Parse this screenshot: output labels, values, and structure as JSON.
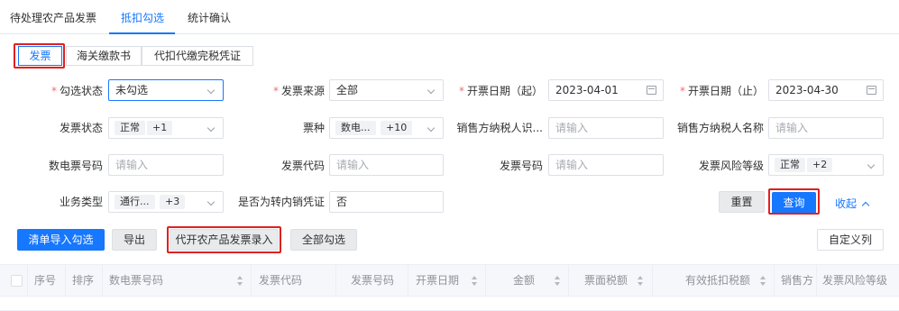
{
  "tabs": [
    "待处理农产品发票",
    "抵扣勾选",
    "统计确认"
  ],
  "subtabs": [
    "发票",
    "海关缴款书",
    "代扣代缴完税凭证"
  ],
  "form": {
    "row1": {
      "select_status_label": "勾选状态",
      "select_status_value": "未勾选",
      "invoice_source_label": "发票来源",
      "invoice_source_value": "全部",
      "date_start_label": "开票日期（起）",
      "date_start_value": "2023-04-01",
      "date_end_label": "开票日期（止）",
      "date_end_value": "2023-04-30"
    },
    "row2": {
      "invoice_status_label": "发票状态",
      "invoice_status_tag": "正常",
      "invoice_status_more": "+1",
      "ticket_type_label": "票种",
      "ticket_type_tag": "数电...",
      "ticket_type_more": "+10",
      "seller_taxid_label": "销售方纳税人识...",
      "seller_taxid_placeholder": "请输入",
      "seller_name_label": "销售方纳税人名称",
      "seller_name_placeholder": "请输入"
    },
    "row3": {
      "digital_no_label": "数电票号码",
      "digital_no_placeholder": "请输入",
      "invoice_code_label": "发票代码",
      "invoice_code_placeholder": "请输入",
      "invoice_no_label": "发票号码",
      "invoice_no_placeholder": "请输入",
      "risk_level_label": "发票风险等级",
      "risk_level_tag": "正常",
      "risk_level_more": "+2"
    },
    "row4": {
      "biz_type_label": "业务类型",
      "biz_type_tag": "通行...",
      "biz_type_more": "+3",
      "transfer_label": "是否为转内销凭证",
      "transfer_value": "否"
    }
  },
  "actions": {
    "reset": "重置",
    "query": "查询",
    "collapse": "收起"
  },
  "toolbar": {
    "import_select": "清单导入勾选",
    "export": "导出",
    "agri_entry": "代开农产品发票录入",
    "select_all": "全部勾选",
    "custom_columns": "自定义列"
  },
  "table": {
    "columns": [
      "序号",
      "排序",
      "数电票号码",
      "发票代码",
      "发票号码",
      "开票日期",
      "金额",
      "票面税额",
      "有效抵扣税额",
      "销售方",
      "发票风险等级"
    ]
  },
  "colors": {
    "accent": "#1677ff",
    "highlight": "#e02020"
  }
}
